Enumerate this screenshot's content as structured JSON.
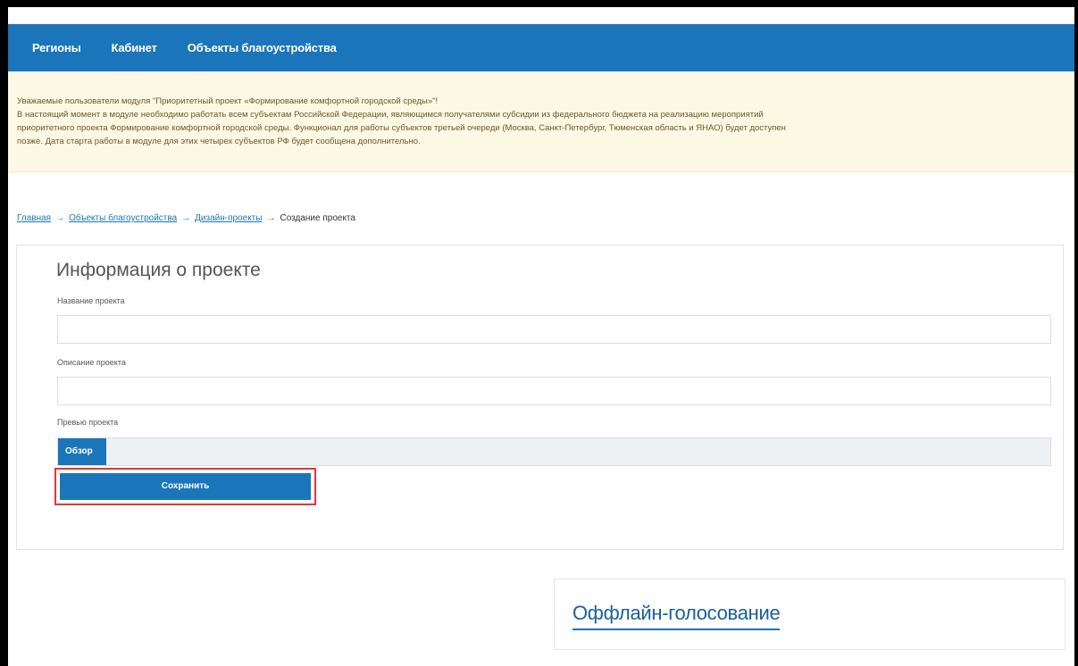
{
  "nav": {
    "items": [
      "Регионы",
      "Кабинет",
      "Объекты благоустройства"
    ]
  },
  "notice": {
    "line1": "Уважаемые пользователи модуля \"Приоритетный проект «Формирование комфортной городской среды»\"!",
    "line2": "В настоящий момент в модуле необходимо работать всем субъектам Российской Федерации, являющимся получателями субсидии из федерального бюджета на реализацию мероприятий",
    "line3": "приоритетного проекта Формирование комфортной городской среды. Функционал для работы субъектов третьей очереди (Москва, Санкт-Петербург, Тюменская область и ЯНАО) будет доступен",
    "line4": "позже. Дата старта работы в модуле для этих четырех субъектов РФ будет сообщена дополнительно."
  },
  "breadcrumb": {
    "home": "Главная",
    "objects": "Объекты благоустройства",
    "design": "Дизайн-проекты",
    "current": "Создание проекта",
    "separator": "→"
  },
  "form": {
    "title": "Информация о проекте",
    "name_label": "Название проекта",
    "name_value": "",
    "description_label": "Описание проекта",
    "description_value": "",
    "files_label": "Превью проекта",
    "browse_label": "Обзор",
    "save_label": "Сохранить"
  },
  "offline": {
    "title": "Оффлайн-голосование"
  },
  "colors": {
    "primary": "#1b75bb",
    "notice_bg": "#fcf8e3",
    "highlight": "#e8343a"
  }
}
